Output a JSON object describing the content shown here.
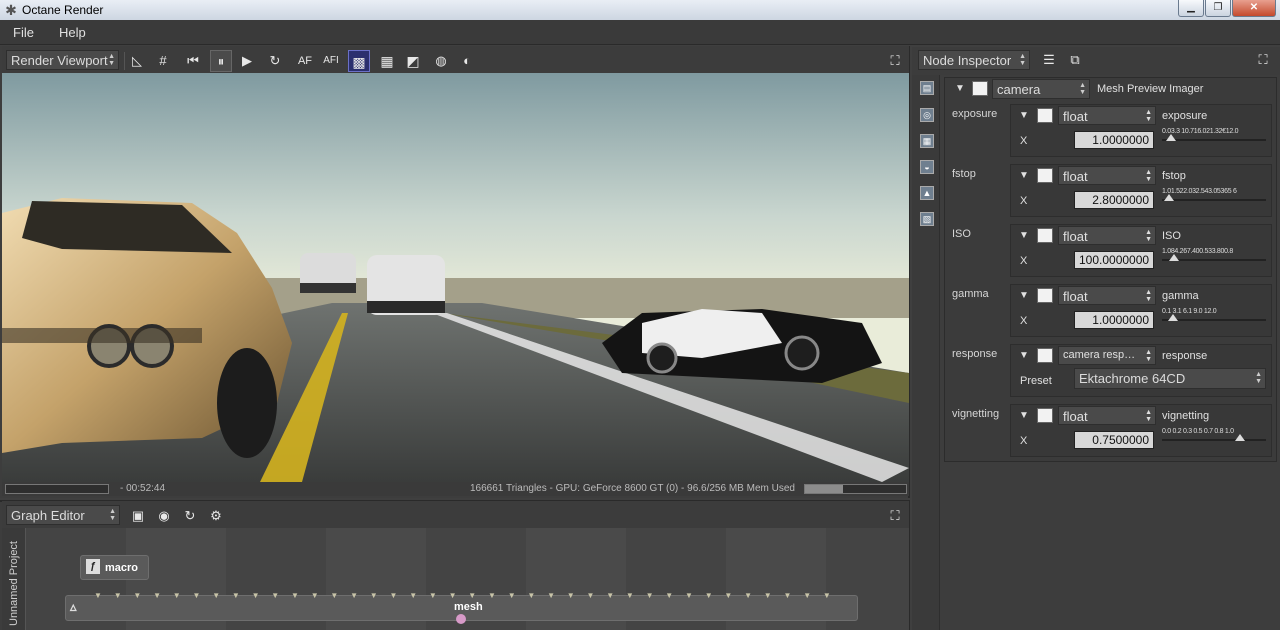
{
  "window": {
    "title": "Octane Render",
    "minimize": "▁",
    "maximize": "❐",
    "close": "✕"
  },
  "menu": [
    "File",
    "Help"
  ],
  "render_viewport": {
    "selector": "Render Viewport",
    "buttons": [
      "AF",
      "AFI"
    ],
    "status": {
      "time": "- 00:52:44",
      "info": "166661 Triangles - GPU: GeForce 8600 GT (0) - 96.6/256 MB Mem Used",
      "mem_fraction": 0.38
    }
  },
  "graph_editor": {
    "selector": "Graph Editor",
    "project_tab": "Unnamed Project",
    "nodes": {
      "macro": "macro",
      "mesh": "mesh"
    }
  },
  "node_inspector": {
    "selector": "Node Inspector",
    "header": {
      "type": "camera",
      "name": "Mesh Preview Imager"
    },
    "params": [
      {
        "label": "exposure",
        "type": "float",
        "name": "exposure",
        "field": "X",
        "value": "1.0000000",
        "ticks": "0.03.3 10.716.021.32€12.0",
        "level": 0.05
      },
      {
        "label": "fstop",
        "type": "float",
        "name": "fstop",
        "field": "X",
        "value": "2.8000000",
        "ticks": "1.01.522.032.543.05365 6",
        "level": 0.03
      },
      {
        "label": "ISO",
        "type": "float",
        "name": "ISO",
        "field": "X",
        "value": "100.0000000",
        "ticks": "1.084.267.400.533.800.8",
        "level": 0.08
      },
      {
        "label": "gamma",
        "type": "float",
        "name": "gamma",
        "field": "X",
        "value": "1.0000000",
        "ticks": "0.1 3.1 6.1 9.0 12.0",
        "level": 0.07
      },
      {
        "label": "response",
        "type": "camera resp…",
        "name": "response",
        "field": "Preset",
        "value": "Ektachrome 64CD"
      },
      {
        "label": "vignetting",
        "type": "float",
        "name": "vignetting",
        "field": "X",
        "value": "0.7500000",
        "ticks": "0.0 0.2 0.3 0.5 0.7 0.8 1.0",
        "level": 0.75
      }
    ]
  }
}
